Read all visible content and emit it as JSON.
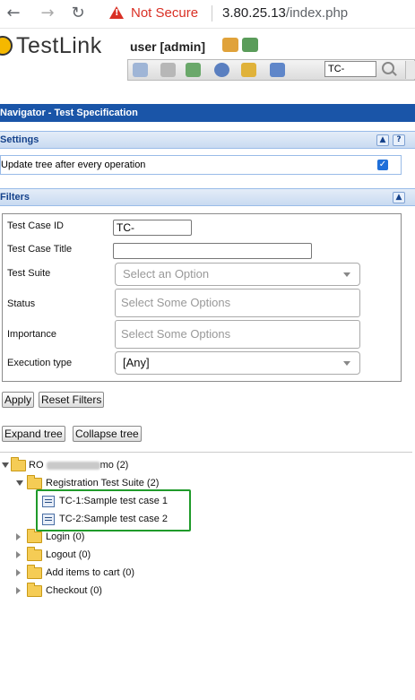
{
  "browser": {
    "back": "←",
    "forward": "→",
    "reload": "↻",
    "not_secure": "Not Secure",
    "url_host": "3.80.25.13",
    "url_path": "/index.php"
  },
  "header": {
    "logo_text": "TestLink",
    "user_label": "user [admin]",
    "tc_search_value": "TC-"
  },
  "navigator": {
    "title": "Navigator - Test Specification"
  },
  "settings": {
    "title": "Settings",
    "option_label": "Update tree after every operation",
    "option_checked": "✓",
    "collapse_btn": "▲",
    "help_btn": "?"
  },
  "filters": {
    "title": "Filters",
    "collapse_btn": "▲",
    "test_case_id_label": "Test Case ID",
    "test_case_id_value": "TC-",
    "test_case_title_label": "Test Case Title",
    "test_case_title_value": "",
    "test_suite_label": "Test Suite",
    "test_suite_placeholder": "Select an Option",
    "status_label": "Status",
    "status_placeholder": "Select Some Options",
    "importance_label": "Importance",
    "importance_placeholder": "Select Some Options",
    "execution_type_label": "Execution type",
    "execution_type_value": "[Any]"
  },
  "buttons": {
    "apply": "Apply",
    "reset": "Reset Filters",
    "expand": "Expand tree",
    "collapse": "Collapse tree"
  },
  "tree": {
    "root": {
      "prefix": "RO",
      "suffix": "mo (2)"
    },
    "suite": "Registration Test Suite (2)",
    "cases": [
      "TC-1:Sample test case 1",
      "TC-2:Sample test case 2"
    ],
    "folders": [
      "Login (0)",
      "Logout (0)",
      "Add items to cart (0)",
      "Checkout (0)"
    ]
  },
  "colors": {
    "nav_bar": "#1a55a8",
    "panel_text": "#15428b",
    "not_secure": "#d93025",
    "highlight": "#1f9a2a"
  }
}
